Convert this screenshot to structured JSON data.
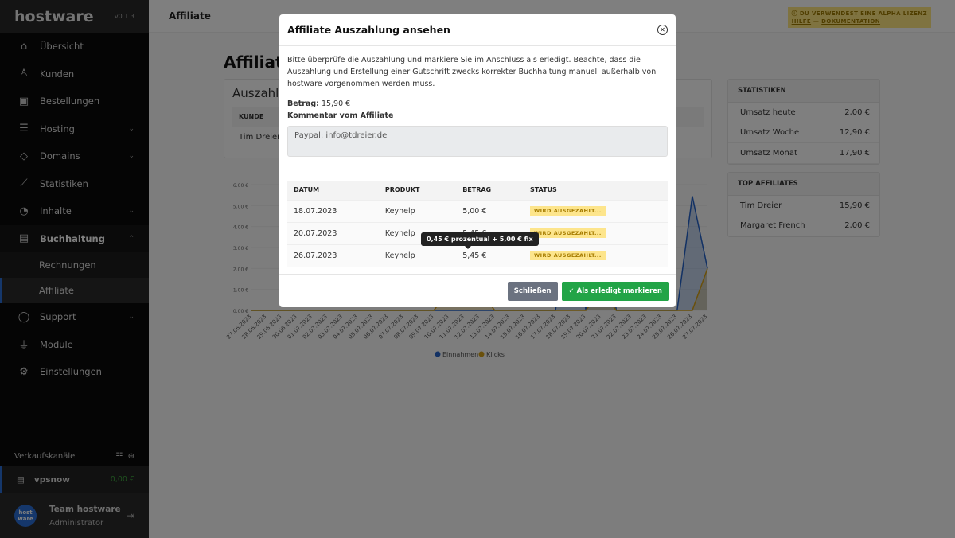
{
  "sidebar": {
    "logo": "hostware",
    "version": "v0.1.3",
    "items": [
      {
        "label": "Übersicht",
        "icon": "⌂"
      },
      {
        "label": "Kunden",
        "icon": "♙"
      },
      {
        "label": "Bestellungen",
        "icon": "▣"
      },
      {
        "label": "Hosting",
        "icon": "☰"
      },
      {
        "label": "Domains",
        "icon": "◇"
      },
      {
        "label": "Statistiken",
        "icon": "⟋"
      },
      {
        "label": "Inhalte",
        "icon": "◔"
      },
      {
        "label": "Buchhaltung",
        "icon": "▤"
      }
    ],
    "sub_items": [
      {
        "label": "Rechnungen"
      },
      {
        "label": "Affiliate"
      }
    ],
    "items2": [
      {
        "label": "Support",
        "icon": "◯"
      },
      {
        "label": "Module",
        "icon": "⏚"
      },
      {
        "label": "Einstellungen",
        "icon": "⚙"
      }
    ],
    "channels_label": "Verkaufskanäle",
    "channel": {
      "name": "vpsnow",
      "amount": "0,00 €"
    },
    "user": {
      "avatar": "host ware",
      "name": "Team hostware",
      "role": "Administrator"
    }
  },
  "header": {
    "title": "Affiliate",
    "alpha_notice": "ⓘ DU VERWENDEST EINE ALPHA LIZENZ",
    "help": "HILFE",
    "sep": " — ",
    "docs": "DOKUMENTATION"
  },
  "page": {
    "title": "Affiliate",
    "payout_title": "Auszahlung",
    "payout_col": "KUNDE",
    "payout_customer": "Tim Dreier"
  },
  "stats": {
    "title": "STATISTIKEN",
    "rows": [
      {
        "label": "Umsatz heute",
        "value": "2,00 €"
      },
      {
        "label": "Umsatz Woche",
        "value": "12,90 €"
      },
      {
        "label": "Umsatz Monat",
        "value": "17,90 €"
      }
    ]
  },
  "top": {
    "title": "TOP AFFILIATES",
    "rows": [
      {
        "label": "Tim Dreier",
        "value": "15,90 €"
      },
      {
        "label": "Margaret French",
        "value": "2,00 €"
      }
    ]
  },
  "modal": {
    "title": "Affiliate Auszahlung ansehen",
    "intro": "Bitte überprüfe die Auszahlung und markiere Sie im Anschluss als erledigt. Beachte, dass die Auszahlung und Erstellung einer Gutschrift zwecks korrekter Buchhaltung manuell außerhalb von hostware vorgenommen werden muss.",
    "amount_label": "Betrag:",
    "amount": " 15,90 €",
    "comment_label": "Kommentar vom Affiliate",
    "comment": "Paypal: info@tdreier.de",
    "columns": [
      "DATUM",
      "PRODUKT",
      "BETRAG",
      "STATUS"
    ],
    "rows": [
      [
        "18.07.2023",
        "Keyhelp",
        "5,00 €",
        "WIRD AUSGEZAHLT..."
      ],
      [
        "20.07.2023",
        "Keyhelp",
        "5,45 €",
        "WIRD AUSGEZAHLT..."
      ],
      [
        "26.07.2023",
        "Keyhelp",
        "5,45 €",
        "WIRD AUSGEZAHLT..."
      ]
    ],
    "tooltip": "0,45 € prozentual + 5,00 € fix",
    "close": "Schließen",
    "confirm": "✓  Als erledigt markieren"
  },
  "chart_data": {
    "type": "area",
    "x": [
      "27.06.2023",
      "28.06.2023",
      "29.06.2023",
      "30.06.2023",
      "01.07.2023",
      "02.07.2023",
      "03.07.2023",
      "04.07.2023",
      "05.07.2023",
      "06.07.2023",
      "07.07.2023",
      "08.07.2023",
      "09.07.2023",
      "10.07.2023",
      "11.07.2023",
      "12.07.2023",
      "13.07.2023",
      "14.07.2023",
      "15.07.2023",
      "16.07.2023",
      "17.07.2023",
      "18.07.2023",
      "19.07.2023",
      "20.07.2023",
      "21.07.2023",
      "22.07.2023",
      "23.07.2023",
      "24.07.2023",
      "25.07.2023",
      "26.07.2023",
      "27.07.2023"
    ],
    "yticks": [
      "0.00 €",
      "1.00 €",
      "2.00 €",
      "3.00 €",
      "4.00 €",
      "5.00 €",
      "6.00 €"
    ],
    "ylim": [
      0,
      6
    ],
    "legend_position": "bottom",
    "series": [
      {
        "name": "Einnahmen",
        "color": "#2563c9",
        "values": [
          0,
          0,
          0,
          0,
          0,
          0,
          0,
          0,
          0,
          0,
          0,
          0,
          0,
          0,
          0,
          0,
          0,
          0,
          0,
          0,
          0,
          5,
          0,
          5.45,
          0,
          0,
          0,
          0,
          0,
          5.45,
          2
        ]
      },
      {
        "name": "Klicks",
        "color": "#d4a017",
        "values": [
          0,
          0,
          0,
          0,
          0,
          0,
          0,
          0,
          0,
          0,
          0,
          0,
          0,
          1,
          1,
          1,
          0,
          0,
          0,
          0,
          0,
          0,
          0,
          1,
          0,
          0,
          0,
          0,
          0,
          0,
          2
        ]
      }
    ]
  }
}
